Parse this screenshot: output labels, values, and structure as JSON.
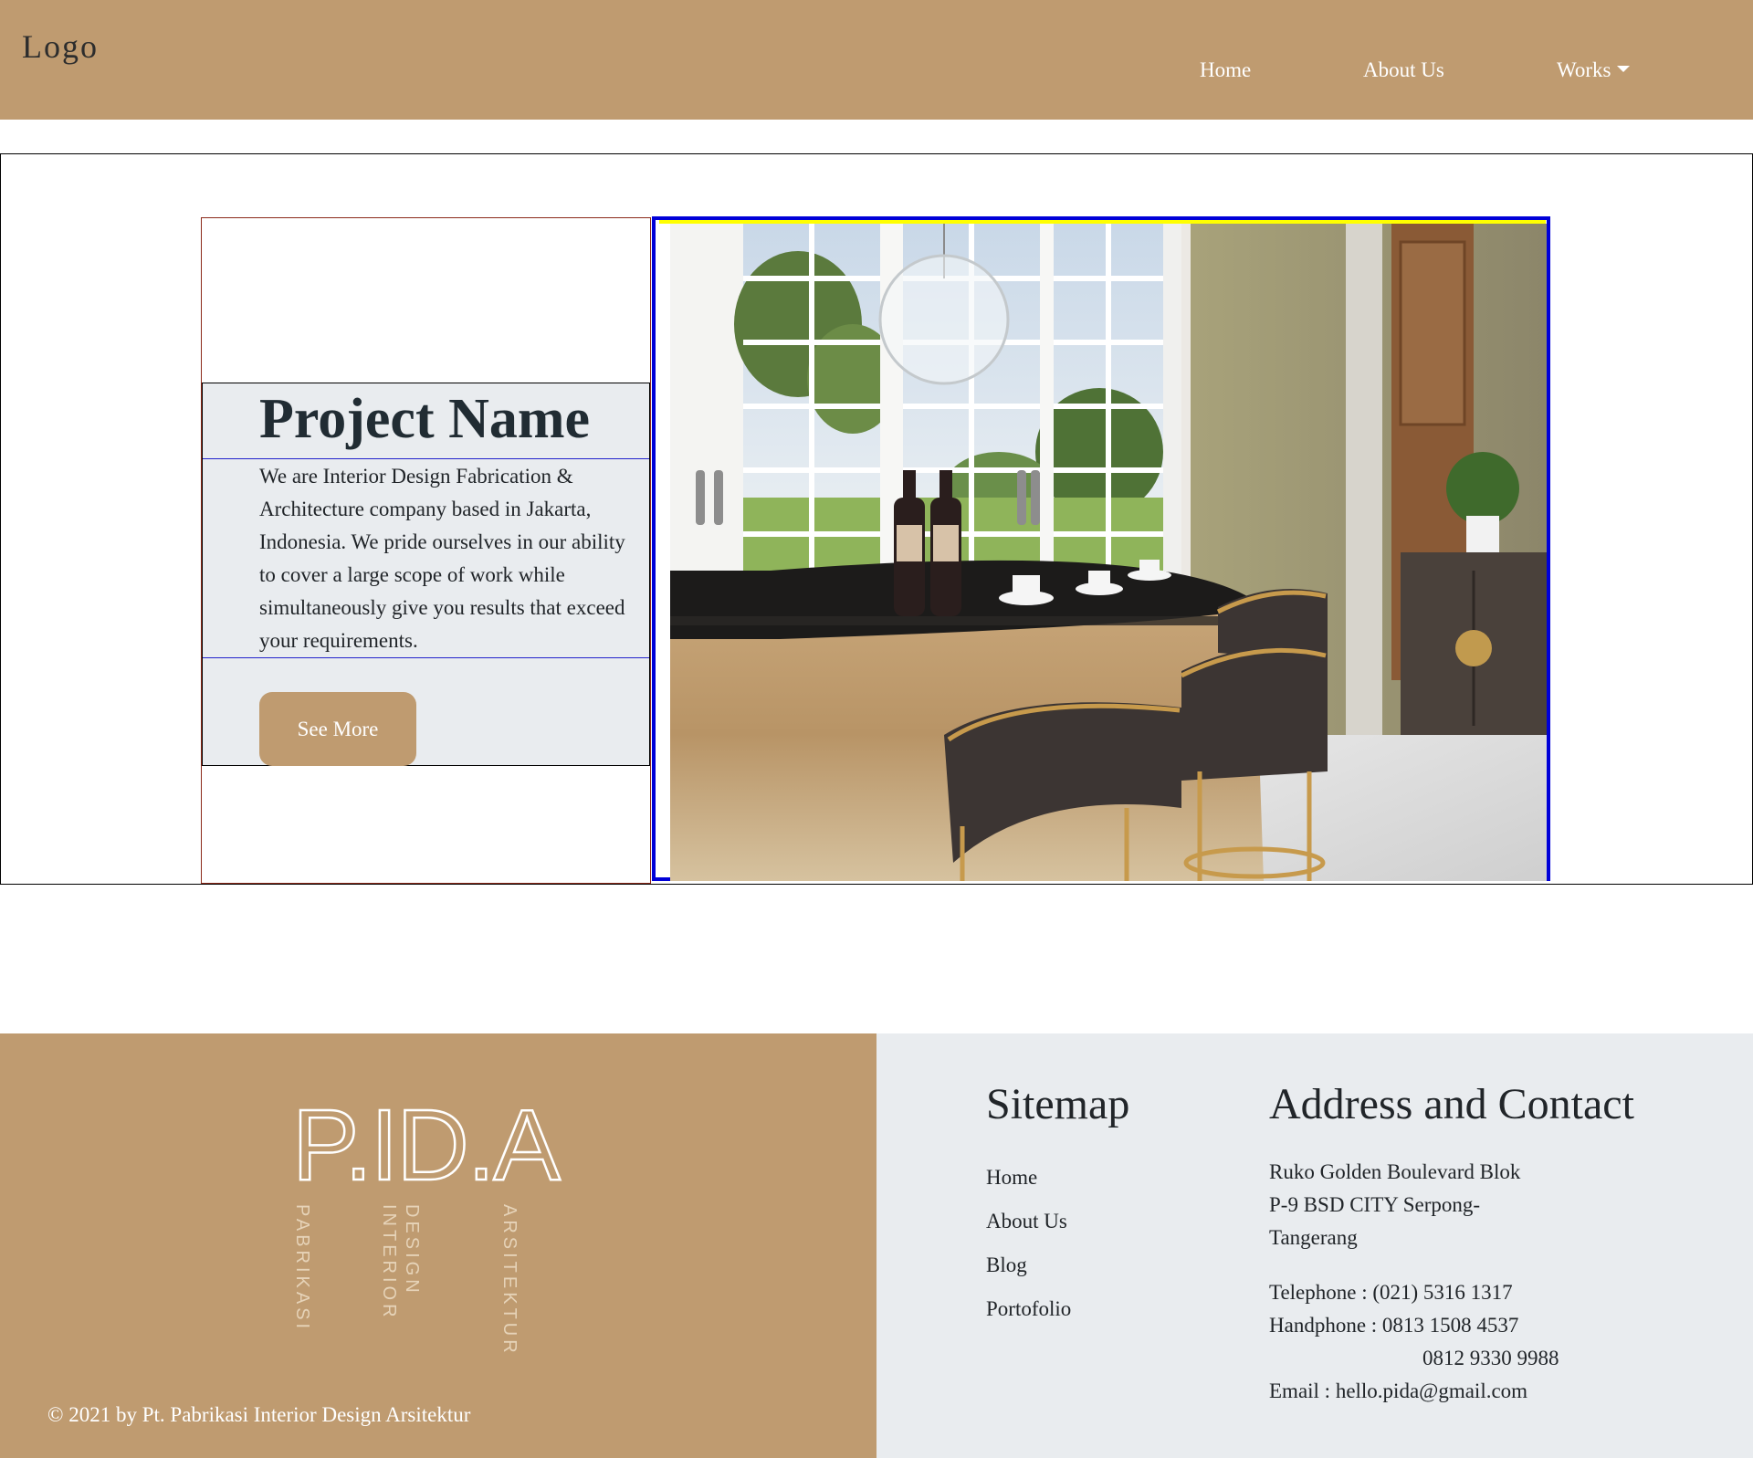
{
  "navbar": {
    "logo": "Logo",
    "items": [
      {
        "label": "Home"
      },
      {
        "label": "About Us"
      },
      {
        "label": "Works"
      }
    ]
  },
  "hero": {
    "title": "Project Name",
    "description": "We are Interior Design Fabrication & Architecture company based in Jakarta, Indonesia. We pride ourselves in our ability to cover a large scope of work while simultaneously give you results that exceed your requirements.",
    "button_label": "See More"
  },
  "footer": {
    "brand": {
      "wordmark": "P.ID.A",
      "vertical_words": [
        "PABRIKASI",
        "INTERIOR",
        "DESIGN",
        "ARSITEKTUR"
      ]
    },
    "copyright": "© 2021 by Pt. Pabrikasi Interior Design Arsitektur",
    "sitemap": {
      "heading": "Sitemap",
      "links": [
        "Home",
        "About Us",
        "Blog",
        "Portofolio"
      ]
    },
    "contact": {
      "heading": "Address and Contact",
      "address_lines": [
        "Ruko Golden Boulevard Blok",
        "P-9 BSD CITY Serpong-",
        "Tangerang"
      ],
      "telephone": "Telephone : (021) 5316 1317",
      "handphone": "Handphone : 0813 1508 4537",
      "handphone_2": "0812 9330 9988",
      "email": "Email : hello.pida@gmail.com"
    }
  },
  "colors": {
    "brand_tan": "#bf9b70",
    "light_gray": "#e9ecef",
    "frame_blue": "#0000d8",
    "frame_yellow": "#ffff00"
  }
}
